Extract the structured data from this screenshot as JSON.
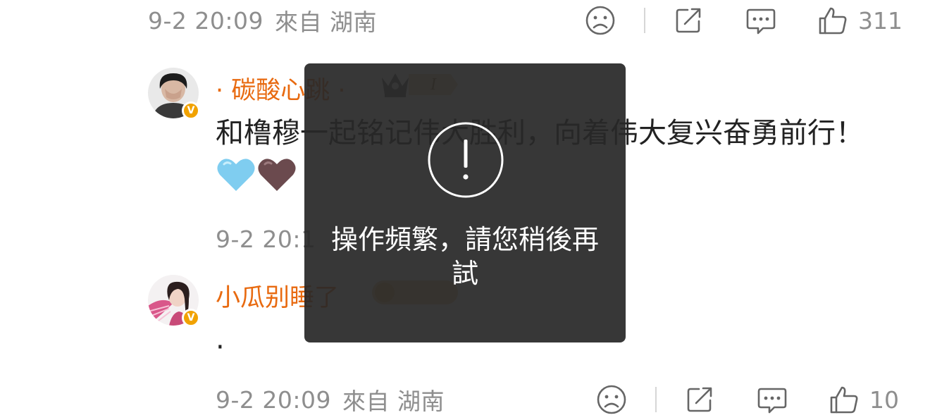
{
  "comment_top": {
    "time": "9-2 20:09",
    "location": "來自 湖南",
    "like_count": "311"
  },
  "comment1": {
    "username": "· 碳酸心跳 ·",
    "level": "I",
    "text": "和橹穆一起铭记伟大胜利，向着伟大复兴奋勇前行！",
    "time": "9-2 20:1",
    "verified_badge": "V"
  },
  "comment2": {
    "username": "小瓜别睡了",
    "fan_badge_text": "",
    "text": "·",
    "time": "9-2 20:09",
    "location": "來自 湖南",
    "like_count": "10",
    "verified_badge": "V"
  },
  "toast": {
    "message": "操作頻繁，請您稍後再試"
  },
  "colors": {
    "username": "#e86a10",
    "meta": "#8e8e8e",
    "toast_bg": "#282828",
    "badge_gold": "#f1a200"
  },
  "icons": [
    "sad-face-icon",
    "share-icon",
    "comment-icon",
    "thumbs-up-icon",
    "exclamation-circle-icon",
    "crown-icon",
    "heart-blue-icon",
    "heart-brown-icon"
  ]
}
